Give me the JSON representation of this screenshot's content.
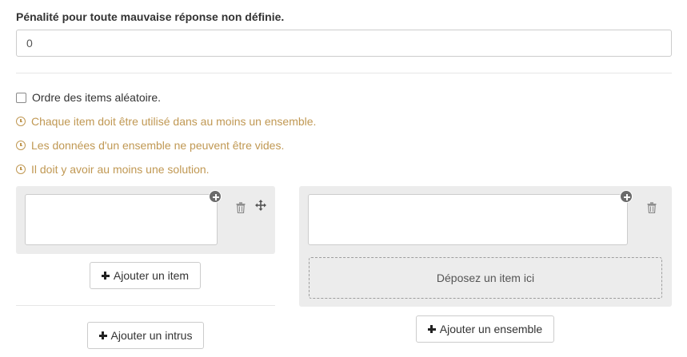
{
  "penalty": {
    "label": "Pénalité pour toute mauvaise réponse non définie.",
    "value": "0"
  },
  "random_order": {
    "label": "Ordre des items aléatoire.",
    "checked": false
  },
  "warnings": [
    "Chaque item doit être utilisé dans au moins un ensemble.",
    "Les données d'un ensemble ne peuvent être vides.",
    "Il doit y avoir au moins une solution."
  ],
  "items_panel": {
    "item_value": "",
    "add_item_label": "Ajouter un item",
    "add_odd_label": "Ajouter un intrus"
  },
  "sets_panel": {
    "set_value": "",
    "drop_zone_label": "Déposez un item ici",
    "add_set_label": "Ajouter un ensemble"
  },
  "colors": {
    "warning": "#c09853",
    "panel_bg": "#ececec",
    "border": "#cccccc"
  },
  "icons": [
    "plus-circle-icon",
    "trash-icon",
    "move-icon",
    "clock-warning-icon",
    "plus-icon"
  ]
}
